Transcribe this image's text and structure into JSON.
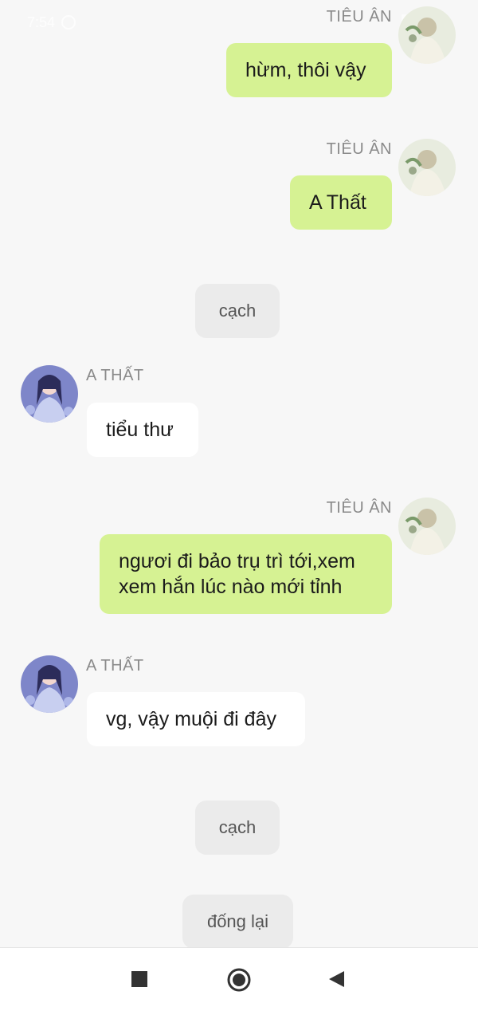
{
  "status_bar": {
    "time": "7:54"
  },
  "messages": [
    {
      "sender": "TIÊU ÂN",
      "side": "right",
      "text": "hừm, thôi vậy"
    },
    {
      "sender": "TIÊU ÂN",
      "side": "right",
      "text": "A Thất"
    },
    {
      "type": "center",
      "text": "cạch"
    },
    {
      "sender": "A THẤT",
      "side": "left",
      "text": "tiểu thư"
    },
    {
      "sender": "TIÊU ÂN",
      "side": "right",
      "text_line1": "ngươi đi bảo trụ trì tới,xem",
      "text_line2": "xem hắn lúc nào mới tỉnh"
    },
    {
      "sender": "A THẤT",
      "side": "left",
      "text": "vg, vậy muội đi đây"
    },
    {
      "type": "center",
      "text": "cạch"
    },
    {
      "type": "center",
      "text": "đống lại"
    }
  ],
  "navbar": {
    "recents": "square-icon",
    "home": "circle-icon",
    "back": "triangle-back-icon"
  }
}
